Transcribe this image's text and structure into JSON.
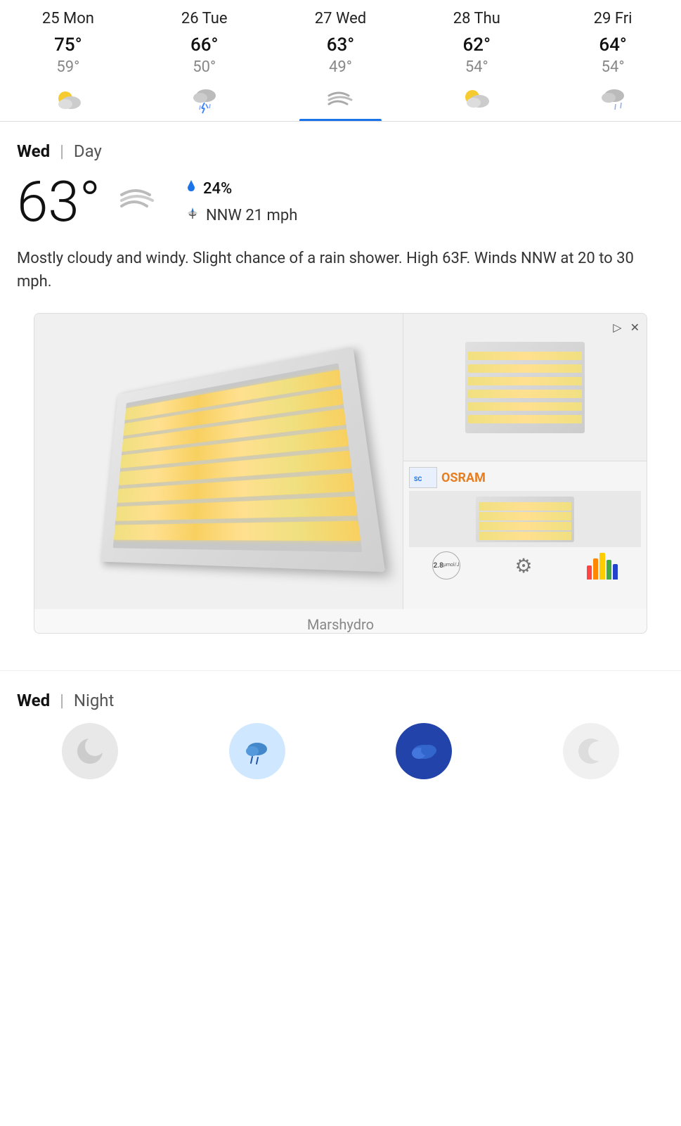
{
  "days": [
    {
      "id": "mon",
      "label": "25 Mon",
      "high": "75°",
      "low": "59°",
      "icon": "partly-cloudy-sun",
      "active": false
    },
    {
      "id": "tue",
      "label": "26 Tue",
      "high": "66°",
      "low": "50°",
      "icon": "thunderstorm",
      "active": false
    },
    {
      "id": "wed",
      "label": "27 Wed",
      "high": "63°",
      "low": "49°",
      "icon": "windy",
      "active": true
    },
    {
      "id": "thu",
      "label": "28 Thu",
      "high": "62°",
      "low": "54°",
      "icon": "partly-cloudy-sun",
      "active": false
    },
    {
      "id": "fri",
      "label": "29 Fri",
      "high": "64°",
      "low": "54°",
      "icon": "rainy-cloudy",
      "active": false
    }
  ],
  "detail": {
    "day_label": "Wed",
    "period_label": "Day",
    "temperature": "63°",
    "precip_percent": "24%",
    "wind_direction": "NNW",
    "wind_speed": "21 mph",
    "description": "Mostly cloudy and windy. Slight chance of a rain shower. High 63F. Winds NNW at 20 to 30 mph."
  },
  "ad": {
    "caption": "Marshydro",
    "brand": "OSRAM",
    "play_label": "▷",
    "close_label": "✕",
    "badge_value": "2.8"
  },
  "night": {
    "day_label": "Wed",
    "period_label": "Night"
  },
  "icons": {
    "rain_drop": "✦",
    "wind_lines": "≋"
  }
}
